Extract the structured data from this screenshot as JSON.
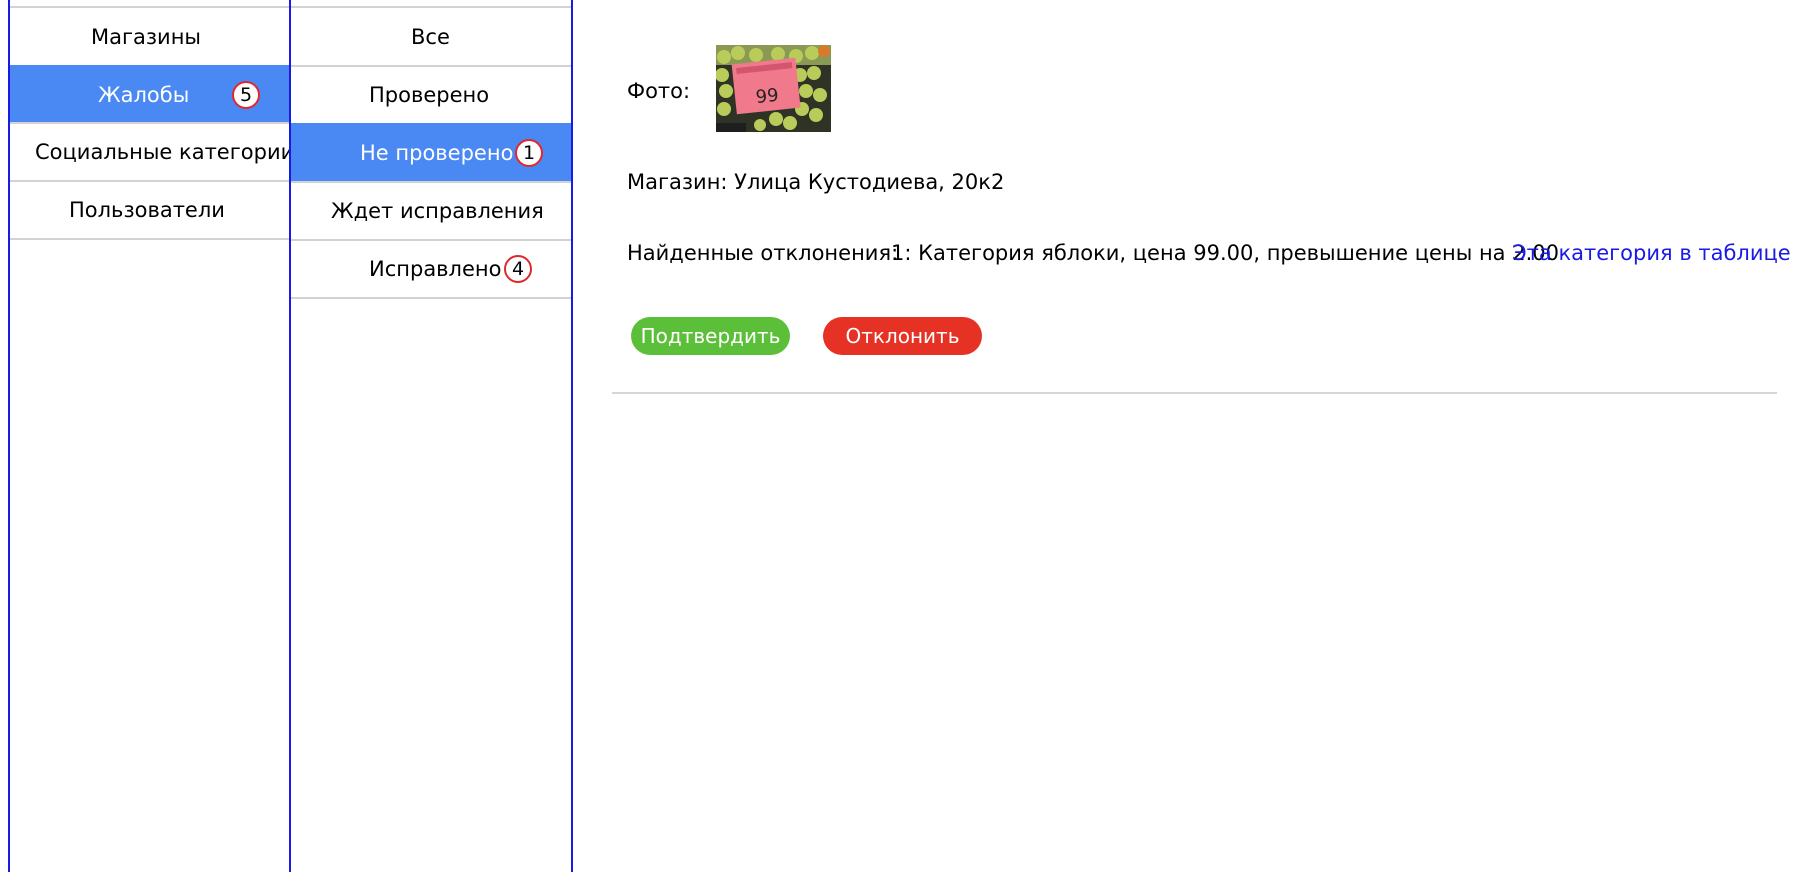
{
  "sidebar": {
    "items": [
      {
        "label": "Магазины"
      },
      {
        "label": "Жалобы",
        "badge": "5"
      },
      {
        "label": "Социальные категории"
      },
      {
        "label": "Пользователи"
      }
    ]
  },
  "filters": {
    "items": [
      {
        "label": "Все"
      },
      {
        "label": "Проверено"
      },
      {
        "label": "Не проверено",
        "badge": "1"
      },
      {
        "label": "Ждет исправления"
      },
      {
        "label": "Исправлено",
        "badge": "4"
      }
    ]
  },
  "detail": {
    "photo_label": "Фото:",
    "photo_icon": "price-tag-apples-photo",
    "photo_price_text": "99",
    "store_text": "Магазин: Улица Кустодиева, 20к2",
    "deviations_label": "Найденные отклонения:",
    "deviation_text": "1: Категория яблоки, цена 99.00, превышение цены на 2.00",
    "category_link": "Эта категория в таблице",
    "confirm_label": "Подтвердить",
    "reject_label": "Отклонить"
  },
  "colors": {
    "active_item": "#4a89f3",
    "column_border": "#1a1ae6",
    "badge_border": "#e0282c",
    "confirm_button": "#5cbf3a",
    "reject_button": "#e63224",
    "link": "#1a1ae6"
  }
}
